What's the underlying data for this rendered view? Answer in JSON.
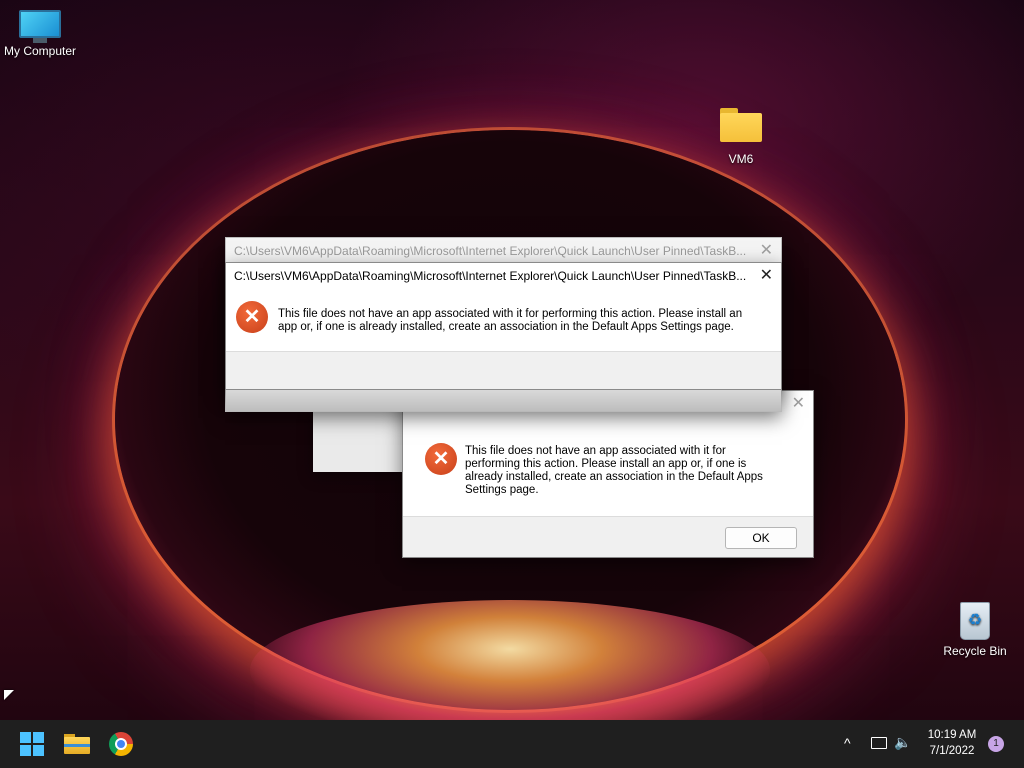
{
  "desktop": {
    "icons": [
      {
        "label": "My Computer",
        "icon": "monitor-icon"
      },
      {
        "label": "VM6",
        "icon": "folder-icon"
      },
      {
        "label": "Recycle Bin",
        "icon": "recycle-bin-icon"
      }
    ]
  },
  "dialog_back": {
    "title": "C:\\Users\\VM6\\AppData\\Roaming\\Microsoft\\Internet Explorer\\Quick Launch\\User Pinned\\TaskB...",
    "close_glyph": "✕"
  },
  "dialog_front": {
    "title": "C:\\Users\\VM6\\AppData\\Roaming\\Microsoft\\Internet Explorer\\Quick Launch\\User Pinned\\TaskB...",
    "message_line1": "This file does not have an app associated with it for performing this action. Please install an",
    "message_line2": "app or, if one is already installed, create an association in the Default Apps Settings page.",
    "close_glyph": "✕",
    "icon": "error-icon"
  },
  "dialog_lower": {
    "message_line1": "This file does not have an app associated with it for",
    "message_line2": "performing this action. Please install an app or, if one is",
    "message_line3": "already installed, create an association in the Default Apps",
    "message_line4": "Settings page.",
    "ok_label": "OK",
    "close_glyph": "✕",
    "icon": "error-icon"
  },
  "taskbar": {
    "apps": [
      {
        "name": "start",
        "icon": "windows-start-icon"
      },
      {
        "name": "file-explorer",
        "icon": "file-explorer-icon"
      },
      {
        "name": "chrome",
        "icon": "chrome-icon"
      }
    ],
    "tray": {
      "chevron": "^",
      "time": "10:19 AM",
      "date": "7/1/2022",
      "notification_count": "1"
    }
  },
  "colors": {
    "accent": "#4cc2ff",
    "error": "#d9481f",
    "taskbar": "#1f1f1f"
  }
}
